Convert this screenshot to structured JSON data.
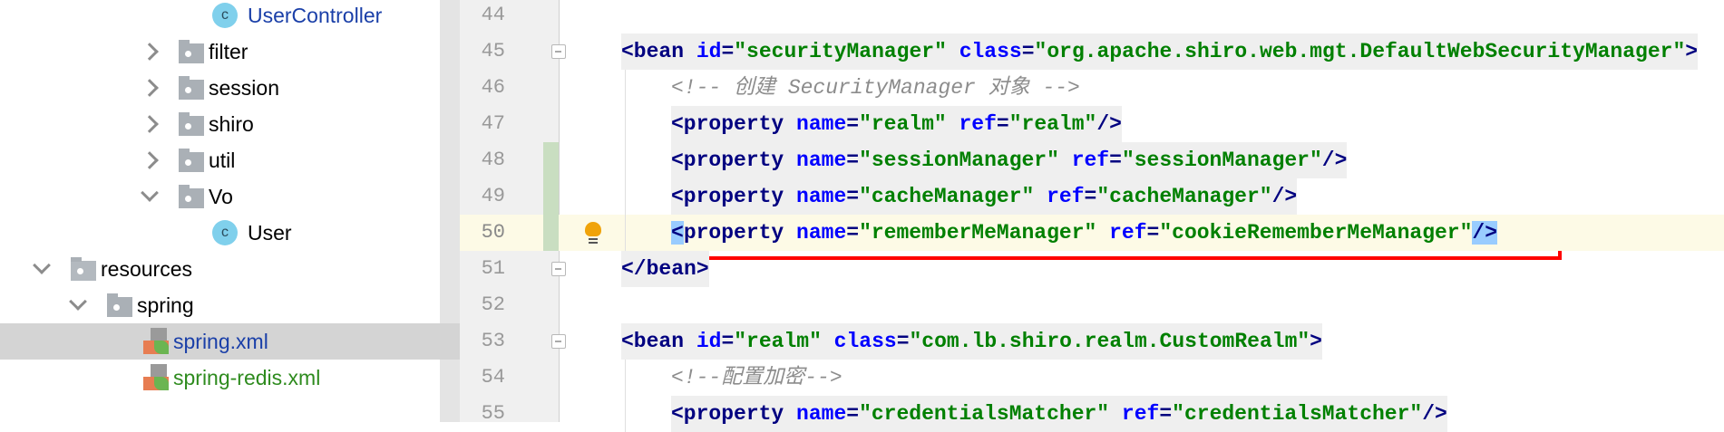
{
  "project_tree": [
    {
      "label": "UserController",
      "kind": "class",
      "level": 3,
      "chevron": "none",
      "color": "#1a3fa8"
    },
    {
      "label": "filter",
      "kind": "folder",
      "level": 2,
      "chevron": "right",
      "color": "#000000"
    },
    {
      "label": "session",
      "kind": "folder",
      "level": 2,
      "chevron": "right",
      "color": "#000000"
    },
    {
      "label": "shiro",
      "kind": "folder",
      "level": 2,
      "chevron": "right",
      "color": "#000000"
    },
    {
      "label": "util",
      "kind": "folder",
      "level": 2,
      "chevron": "right",
      "color": "#000000"
    },
    {
      "label": "Vo",
      "kind": "folder",
      "level": 2,
      "chevron": "down",
      "color": "#000000"
    },
    {
      "label": "User",
      "kind": "class",
      "level": 3,
      "chevron": "none",
      "color": "#000000"
    },
    {
      "label": "resources",
      "kind": "resources",
      "level": 0,
      "chevron": "down",
      "color": "#000000"
    },
    {
      "label": "spring",
      "kind": "folder",
      "level": 1,
      "chevron": "down",
      "color": "#000000"
    },
    {
      "label": "spring.xml",
      "kind": "xml",
      "level": 2,
      "chevron": "none",
      "color": "#1a3fa8",
      "selected": true
    },
    {
      "label": "spring-redis.xml",
      "kind": "xml",
      "level": 2,
      "chevron": "none",
      "color": "#2e8b1e"
    }
  ],
  "editor": {
    "current_line": 50,
    "changed_lines": [
      48,
      49,
      50
    ],
    "lines": [
      {
        "n": "44",
        "indent": 0,
        "tokens": []
      },
      {
        "n": "45",
        "indent": 0,
        "fold": true,
        "tokens": [
          [
            "tag",
            "<bean "
          ],
          [
            "attr",
            "id"
          ],
          [
            "tag",
            "="
          ],
          [
            "val",
            "\"securityManager\" "
          ],
          [
            "attr",
            "class"
          ],
          [
            "tag",
            "="
          ],
          [
            "val",
            "\"org.apache.shiro.web.mgt.DefaultWebSecurityManager\""
          ],
          [
            "tag",
            ">"
          ]
        ]
      },
      {
        "n": "46",
        "indent": 1,
        "tokens": [
          [
            "com",
            "<!-- 创建 SecurityManager 对象 -->"
          ]
        ]
      },
      {
        "n": "47",
        "indent": 1,
        "tokens": [
          [
            "tag",
            "<property "
          ],
          [
            "attr",
            "name"
          ],
          [
            "tag",
            "="
          ],
          [
            "val",
            "\"realm\" "
          ],
          [
            "attr",
            "ref"
          ],
          [
            "tag",
            "="
          ],
          [
            "val",
            "\"realm\""
          ],
          [
            "tag",
            "/>"
          ]
        ]
      },
      {
        "n": "48",
        "indent": 1,
        "tokens": [
          [
            "tag",
            "<property "
          ],
          [
            "attr",
            "name"
          ],
          [
            "tag",
            "="
          ],
          [
            "val",
            "\"sessionManager\" "
          ],
          [
            "attr",
            "ref"
          ],
          [
            "tag",
            "="
          ],
          [
            "val",
            "\"sessionManager\""
          ],
          [
            "tag",
            "/>"
          ]
        ]
      },
      {
        "n": "49",
        "indent": 1,
        "tokens": [
          [
            "tag",
            "<property "
          ],
          [
            "attr",
            "name"
          ],
          [
            "tag",
            "="
          ],
          [
            "val",
            "\"cacheManager\" "
          ],
          [
            "attr",
            "ref"
          ],
          [
            "tag",
            "="
          ],
          [
            "val",
            "\"cacheManager\""
          ],
          [
            "tag",
            "/>"
          ]
        ]
      },
      {
        "n": "50",
        "indent": 1,
        "bulb": true,
        "boxed": true,
        "tokens": [
          [
            "brace",
            "<"
          ],
          [
            "tag",
            "property "
          ],
          [
            "attr",
            "name"
          ],
          [
            "tag",
            "="
          ],
          [
            "val",
            "\"rememberMeManager\" "
          ],
          [
            "attr",
            "ref"
          ],
          [
            "tag",
            "="
          ],
          [
            "val",
            "\"cookieRememberMeManager\""
          ],
          [
            "brace",
            "/>"
          ]
        ]
      },
      {
        "n": "51",
        "indent": 0,
        "fold": true,
        "tokens": [
          [
            "tag",
            "</bean>"
          ]
        ]
      },
      {
        "n": "52",
        "indent": 0,
        "tokens": []
      },
      {
        "n": "53",
        "indent": 0,
        "fold": true,
        "tokens": [
          [
            "tag",
            "<bean "
          ],
          [
            "attr",
            "id"
          ],
          [
            "tag",
            "="
          ],
          [
            "val",
            "\"realm\" "
          ],
          [
            "attr",
            "class"
          ],
          [
            "tag",
            "="
          ],
          [
            "val",
            "\"com.lb.shiro.realm.CustomRealm\""
          ],
          [
            "tag",
            ">"
          ]
        ]
      },
      {
        "n": "54",
        "indent": 1,
        "tokens": [
          [
            "com",
            "<!--配置加密-->"
          ]
        ]
      },
      {
        "n": "55",
        "indent": 1,
        "tokens": [
          [
            "tag",
            "<property "
          ],
          [
            "attr",
            "name"
          ],
          [
            "tag",
            "="
          ],
          [
            "val",
            "\"credentialsMatcher\" "
          ],
          [
            "attr",
            "ref"
          ],
          [
            "tag",
            "="
          ],
          [
            "val",
            "\"credentialsMatcher\""
          ],
          [
            "tag",
            "/>"
          ]
        ]
      }
    ]
  }
}
